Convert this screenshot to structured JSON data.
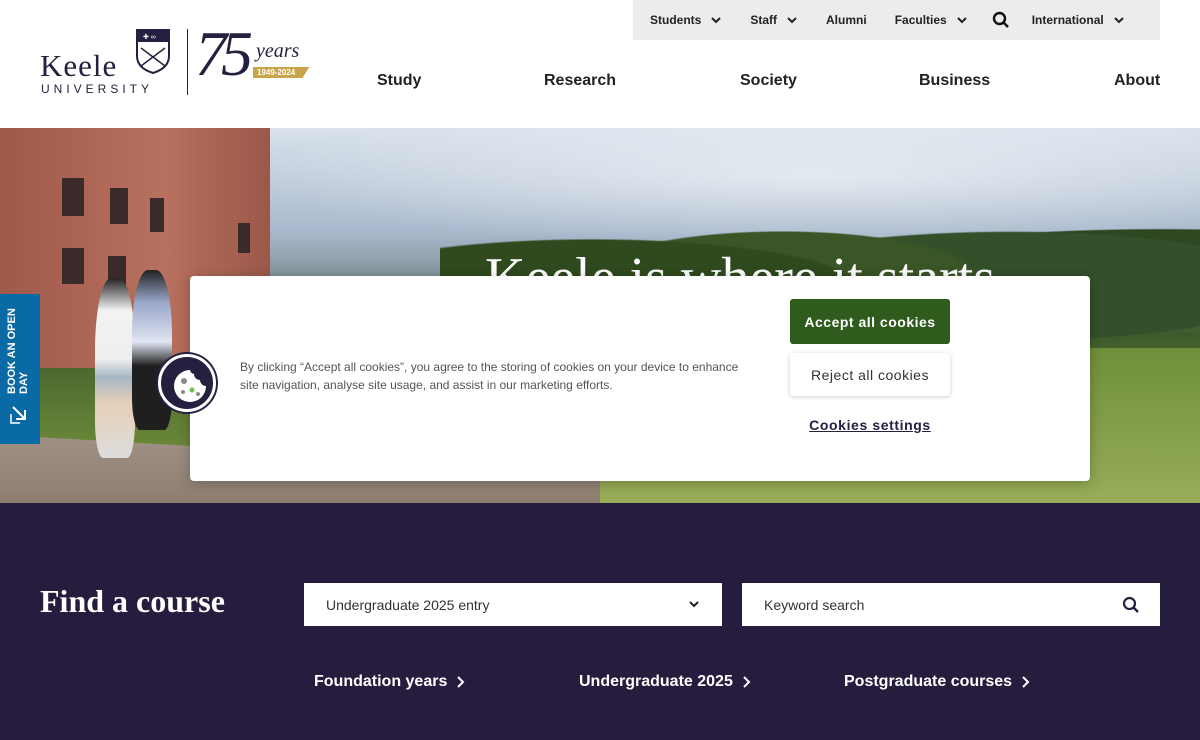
{
  "utility_nav": {
    "items": [
      {
        "label": "Students",
        "has_dropdown": true
      },
      {
        "label": "Staff",
        "has_dropdown": true
      },
      {
        "label": "Alumni",
        "has_dropdown": false
      },
      {
        "label": "Faculties",
        "has_dropdown": true
      },
      {
        "label": "International",
        "has_dropdown": true
      }
    ],
    "search_icon": "search-icon"
  },
  "logo": {
    "name": "Keele",
    "subtitle": "UNIVERSITY",
    "anniversary": "75",
    "anniversary_word": "years",
    "dates": "1949-2024"
  },
  "main_nav": {
    "items": [
      "Study",
      "Research",
      "Society",
      "Business",
      "About"
    ]
  },
  "hero": {
    "title_partial": "Keele is where it starts",
    "open_day_label": "BOOK AN OPEN DAY"
  },
  "cookie_banner": {
    "text": "By clicking “Accept all cookies”, you agree to the storing of cookies on your device to enhance site navigation, analyse site usage, and assist in our marketing efforts.",
    "accept_label": "Accept all cookies",
    "reject_label": "Reject all cookies",
    "settings_label": "Cookies settings"
  },
  "find_course": {
    "title": "Find a course",
    "select_value": "Undergraduate 2025 entry",
    "search_placeholder": "Keyword search",
    "links": [
      "Foundation years",
      "Undergraduate 2025",
      "Postgraduate courses"
    ]
  },
  "colors": {
    "brand_navy": "#261c3d",
    "accept_green": "#2f5b1c",
    "open_day_blue": "#0a6aa6",
    "anniversary_gold": "#c8a44a"
  }
}
